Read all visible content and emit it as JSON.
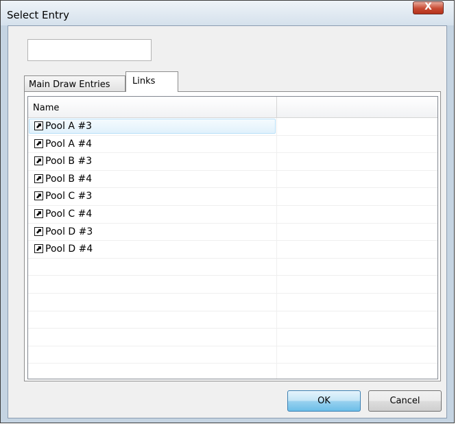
{
  "window": {
    "title": "Select Entry",
    "close_symbol": "X"
  },
  "search": {
    "value": "",
    "placeholder": ""
  },
  "tabs": [
    {
      "label": "Main Draw Entries",
      "active": false
    },
    {
      "label": "Links",
      "active": true
    }
  ],
  "list": {
    "columns": [
      "Name",
      ""
    ],
    "rows": [
      {
        "name": "Pool A #3",
        "icon": "shortcut-link-icon",
        "selected": true
      },
      {
        "name": "Pool A #4",
        "icon": "shortcut-link-icon"
      },
      {
        "name": "Pool B #3",
        "icon": "shortcut-link-icon"
      },
      {
        "name": "Pool B #4",
        "icon": "shortcut-link-icon"
      },
      {
        "name": "Pool C #3",
        "icon": "shortcut-link-icon"
      },
      {
        "name": "Pool C #4",
        "icon": "shortcut-link-icon"
      },
      {
        "name": "Pool D #3",
        "icon": "shortcut-link-icon"
      },
      {
        "name": "Pool D #4",
        "icon": "shortcut-link-icon"
      }
    ]
  },
  "buttons": {
    "ok": "OK",
    "cancel": "Cancel"
  }
}
